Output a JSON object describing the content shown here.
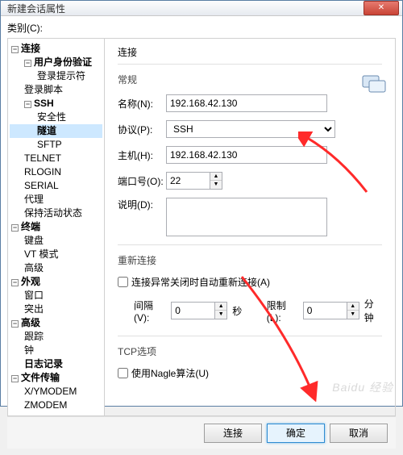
{
  "window": {
    "title": "新建会话属性",
    "close_glyph": "✕"
  },
  "category_label": "类别(C):",
  "tree": {
    "l1_connection": "连接",
    "l2_auth": "用户身份验证",
    "l3_login_prompt": "登录提示符",
    "l2_login_script": "登录脚本",
    "l2_ssh": "SSH",
    "l3_security": "安全性",
    "l3_tunnel": "隧道",
    "l3_sftp": "SFTP",
    "l2_telnet": "TELNET",
    "l2_rlogin": "RLOGIN",
    "l2_serial": "SERIAL",
    "l2_proxy": "代理",
    "l2_keepalive": "保持活动状态",
    "l1_terminal": "终端",
    "l2_keyboard": "键盘",
    "l2_vt": "VT 模式",
    "l2_advanced_term": "高级",
    "l1_appearance": "外观",
    "l2_window": "窗口",
    "l2_highlight": "突出",
    "l1_advanced": "高级",
    "l2_trace": "跟踪",
    "l2_bell": "钟",
    "l2_logging": "日志记录",
    "l1_filetransfer": "文件传输",
    "l2_xymodem": "X/YMODEM",
    "l2_zmodem": "ZMODEM"
  },
  "panel": {
    "title": "连接",
    "section_general": "常规",
    "name_label": "名称(N):",
    "name_value": "192.168.42.130",
    "protocol_label": "协议(P):",
    "protocol_value": "SSH",
    "host_label": "主机(H):",
    "host_value": "192.168.42.130",
    "port_label": "端口号(O):",
    "port_value": "22",
    "desc_label": "说明(D):",
    "desc_value": "",
    "section_reconnect": "重新连接",
    "reconnect_checkbox": "连接异常关闭时自动重新连接(A)",
    "interval_label": "间隔(V):",
    "interval_value": "0",
    "interval_unit": "秒",
    "limit_label": "限制(L):",
    "limit_value": "0",
    "limit_unit": "分钟",
    "section_tcp": "TCP选项",
    "nagle_checkbox": "使用Nagle算法(U)"
  },
  "buttons": {
    "connect": "连接",
    "ok": "确定",
    "cancel": "取消"
  },
  "watermark": "Baidu 经验"
}
